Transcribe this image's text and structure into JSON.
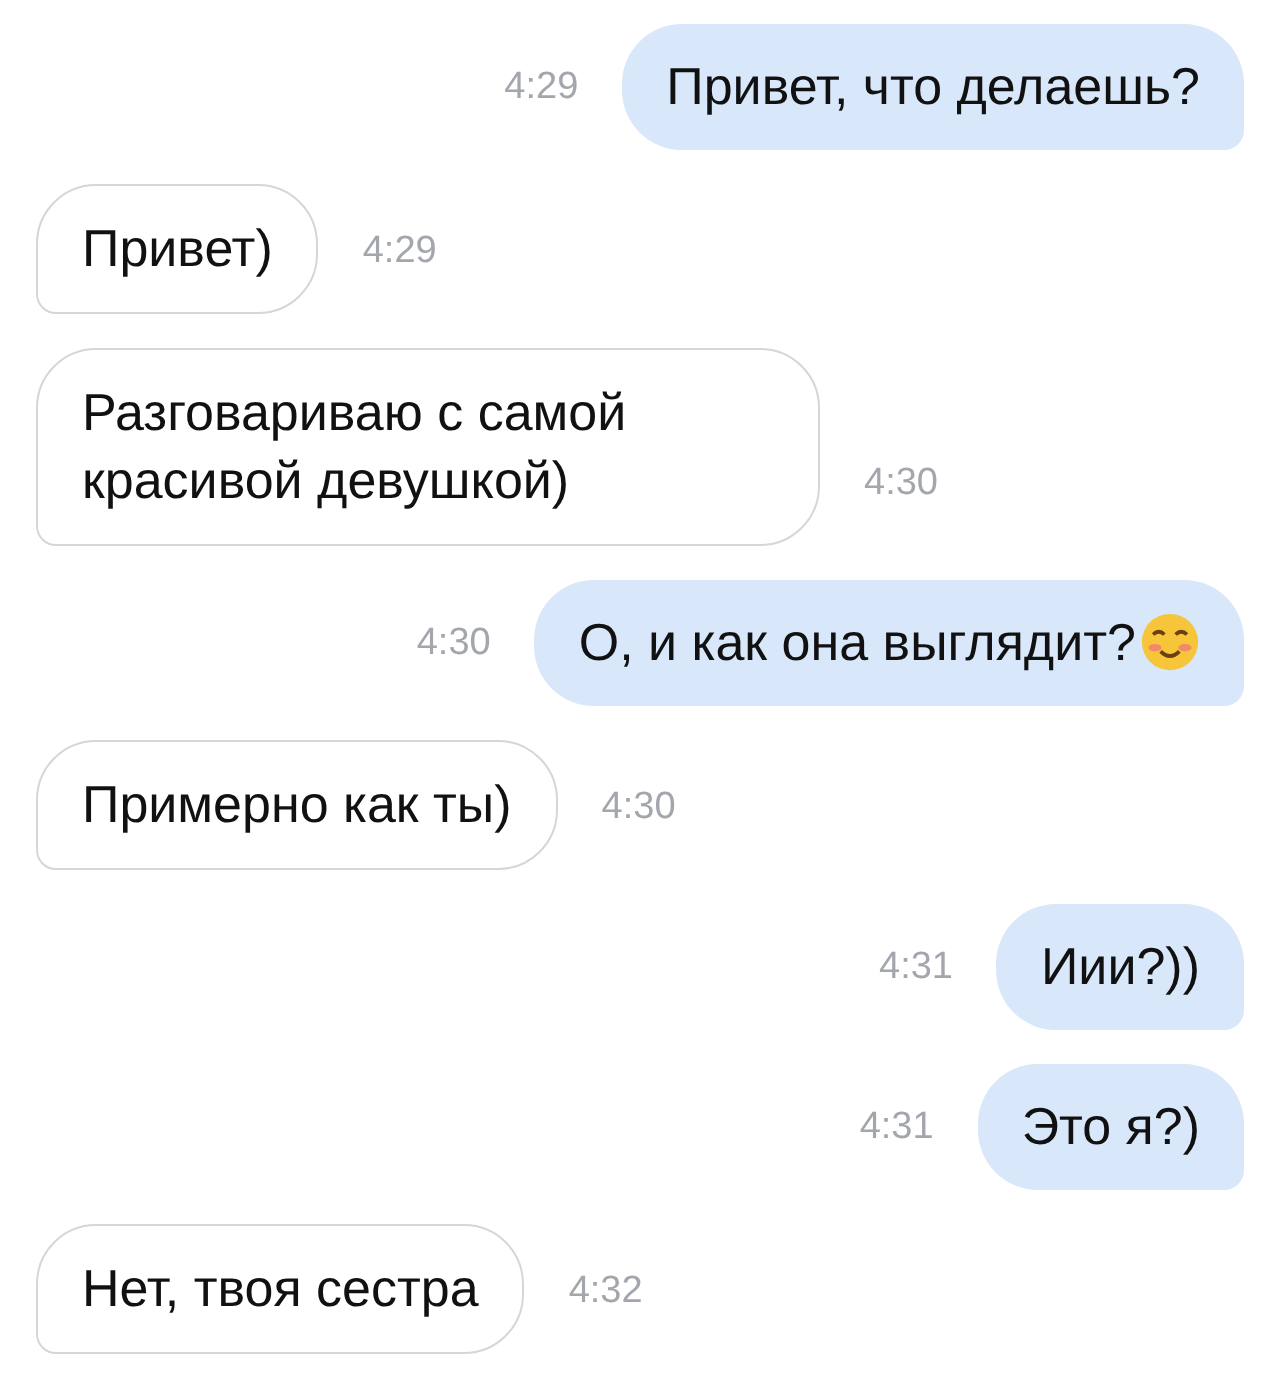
{
  "messages": [
    {
      "kind": "outgoing",
      "text": "Привет, что делаешь?",
      "time": "4:29"
    },
    {
      "kind": "incoming",
      "text": "Привет)",
      "time": "4:29"
    },
    {
      "kind": "incoming",
      "text": "Разговариваю с самой красивой девушкой)",
      "time": "4:30"
    },
    {
      "kind": "outgoing",
      "text": "О, и как она выглядит?",
      "emoji": true,
      "time": "4:30"
    },
    {
      "kind": "incoming",
      "text": "Примерно как ты)",
      "time": "4:30"
    },
    {
      "kind": "outgoing",
      "text": "Иии?))",
      "time": "4:31"
    },
    {
      "kind": "outgoing",
      "text": "Это я?)",
      "time": "4:31"
    },
    {
      "kind": "incoming",
      "text": "Нет, твоя сестра",
      "time": "4:32"
    }
  ]
}
